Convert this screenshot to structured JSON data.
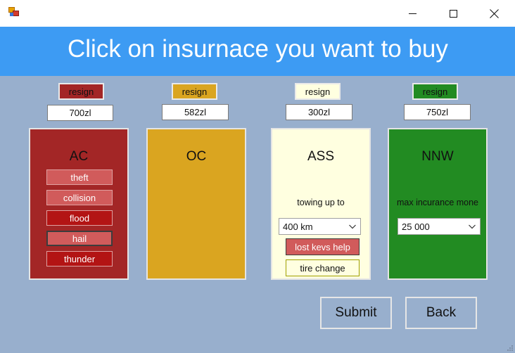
{
  "window": {
    "icon": "winforms-app-icon",
    "controls": {
      "minimize_icon": "minimize-icon",
      "maximize_icon": "maximize-icon",
      "close_icon": "close-icon"
    }
  },
  "header": {
    "title": "Click on insurnace you want to buy",
    "color": "#3d9bf3"
  },
  "colors": {
    "background": "#98afcd",
    "ac": "#a32626",
    "oc": "#daa520",
    "ass": "#ffffe0",
    "nnw": "#228b22"
  },
  "panels": [
    {
      "id": "ac",
      "resign_label": "resign",
      "price": "700zl",
      "title": "AC",
      "options": [
        {
          "label": "theft",
          "style": "light"
        },
        {
          "label": "collision",
          "style": "light"
        },
        {
          "label": "flood",
          "style": "dark"
        },
        {
          "label": "hail",
          "style": "light",
          "selected": true
        },
        {
          "label": "thunder",
          "style": "dark"
        }
      ]
    },
    {
      "id": "oc",
      "resign_label": "resign",
      "price": "582zl",
      "title": "OC"
    },
    {
      "id": "ass",
      "resign_label": "resign",
      "price": "300zl",
      "title": "ASS",
      "towing_label": "towing up to",
      "towing_value": "400 km",
      "lost_keys_label": "lost kevs help",
      "tire_change_label": "tire change"
    },
    {
      "id": "nnw",
      "resign_label": "resign",
      "price": "750zl",
      "title": "NNW",
      "max_label": "max incurance mone",
      "max_value": "25 000"
    }
  ],
  "actions": {
    "submit": "Submit",
    "back": "Back"
  }
}
